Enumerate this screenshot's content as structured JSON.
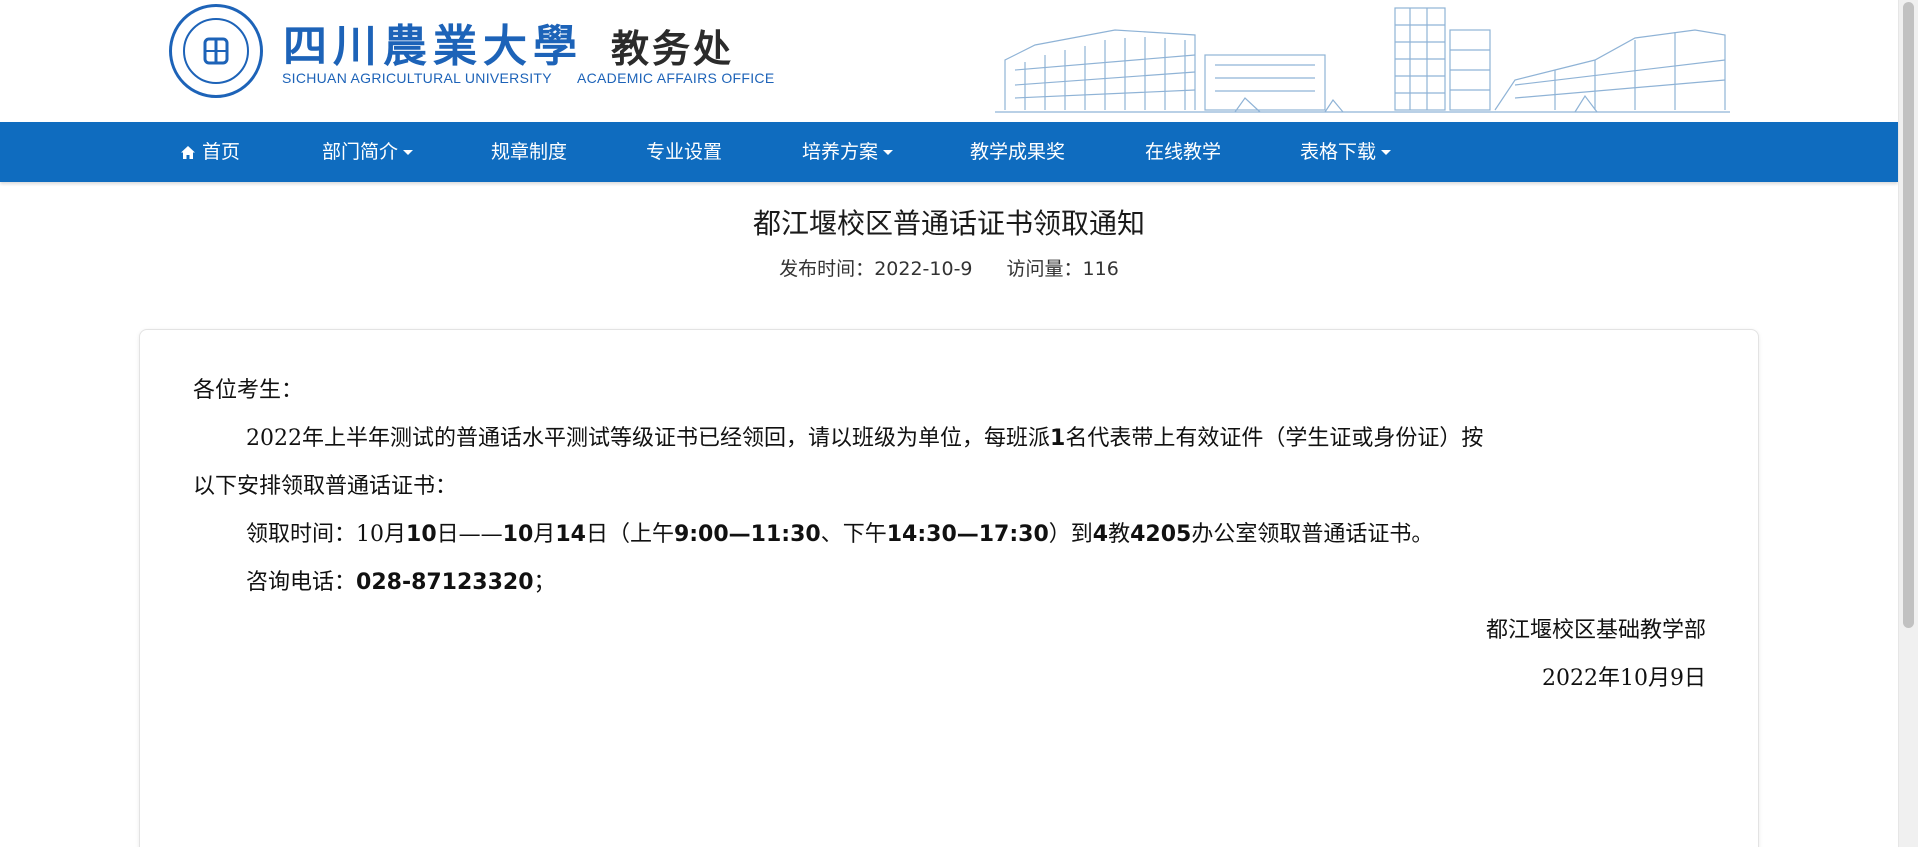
{
  "header": {
    "university_cn": "四川農業大學",
    "office_cn": "教务处",
    "university_en": "SICHUAN AGRICULTURAL UNIVERSITY",
    "office_en": "ACADEMIC AFFAIRS OFFICE"
  },
  "nav": {
    "items": [
      {
        "label": "首页",
        "icon": "home-icon",
        "dropdown": false
      },
      {
        "label": "部门简介",
        "dropdown": true
      },
      {
        "label": "规章制度",
        "dropdown": false
      },
      {
        "label": "专业设置",
        "dropdown": false
      },
      {
        "label": "培养方案",
        "dropdown": true
      },
      {
        "label": "教学成果奖",
        "dropdown": false
      },
      {
        "label": "在线教学",
        "dropdown": false
      },
      {
        "label": "表格下载",
        "dropdown": true
      }
    ],
    "background_color": "#0f6cbf"
  },
  "article": {
    "title": "都江堰校区普通话证书领取通知",
    "publish_label": "发布时间：",
    "publish_date": "2022-10-9",
    "views_label": "访问量：",
    "views": "116",
    "salutation": "各位考生：",
    "p1_line1": "2022年上半年测试的普通话水平测试等级证书已经领回，请以班级为单位，每班派",
    "p1_bold": "1",
    "p1_line1_end": "名代表带上有效证件（学生证或身份证）按",
    "p1_line2": "以下安排领取普通话证书：",
    "p2_prefix": "领取时间：",
    "p2_a": "10",
    "p2_b": "月",
    "p2_c": "10",
    "p2_d": "日——",
    "p2_e": "10",
    "p2_f": "月",
    "p2_g": "14",
    "p2_h": "日（上午",
    "p2_i": "9:00—11:30",
    "p2_j": "、下午",
    "p2_k": "14:30—17:30",
    "p2_l": "）到",
    "p2_m": "4",
    "p2_n": "教",
    "p2_o": "4205",
    "p2_p": "办公室领取普通话证书。",
    "p3_label": "咨询电话：",
    "p3_phone": "028-87123320",
    "p3_end": "；",
    "signature": "都江堰校区基础教学部",
    "sign_date": "2022年10月9日"
  }
}
